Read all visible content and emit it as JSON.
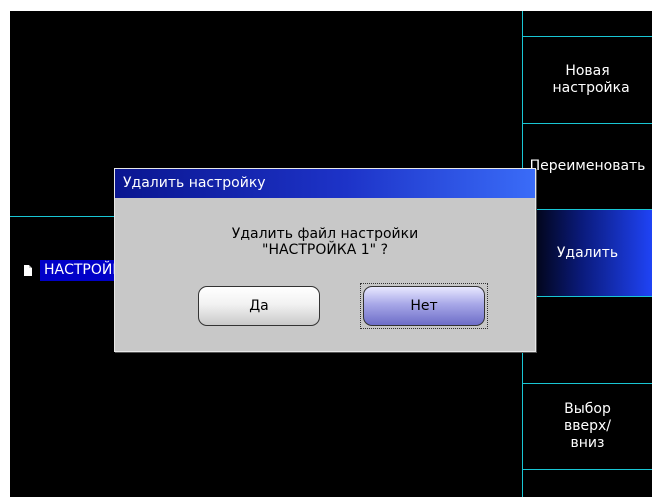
{
  "softkeys": [
    {
      "label": ""
    },
    {
      "label": "Новая настройка"
    },
    {
      "label": "Переименовать"
    },
    {
      "label": "Удалить"
    },
    {
      "label": ""
    },
    {
      "label": "Выбор вверх/вниз"
    },
    {
      "label": ""
    }
  ],
  "file_list": {
    "items": [
      {
        "name": "НАСТРОЙКА 1"
      }
    ]
  },
  "dialog": {
    "title": "Удалить настройку",
    "message_line1": "Удалить файл настройки",
    "message_line2": "\"НАСТРОЙКА 1\" ?",
    "yes_label": "Да",
    "no_label": "Нет"
  },
  "colors": {
    "screen_bg": "#000000",
    "divider": "#19c6d4",
    "dialog_bg": "#c8c8c8",
    "title_bar": "#1d33c8",
    "selection": "#0000c8"
  }
}
